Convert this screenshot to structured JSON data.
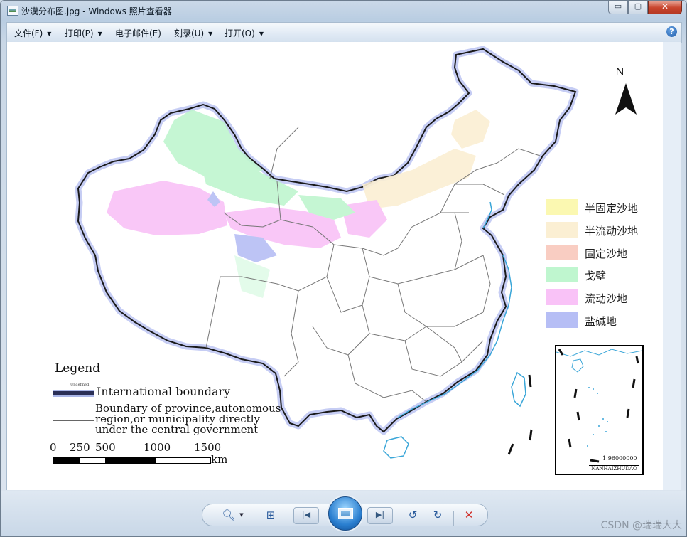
{
  "window": {
    "title": "沙漠分布图.jpg - Windows 照片查看器",
    "controls": {
      "minimize": "▭",
      "maximize": "▢",
      "close": "✕"
    }
  },
  "menu": {
    "items": [
      {
        "label": "文件(F)",
        "has_dropdown": true
      },
      {
        "label": "打印(P)",
        "has_dropdown": true
      },
      {
        "label": "电子邮件(E)",
        "has_dropdown": false
      },
      {
        "label": "刻录(U)",
        "has_dropdown": true
      },
      {
        "label": "打开(O)",
        "has_dropdown": true
      }
    ],
    "dropdown_glyph": "▼",
    "help_glyph": "?"
  },
  "map": {
    "north_label": "N",
    "legend": {
      "title": "Legend",
      "undefined_tag": "Undefined",
      "international_boundary": "International boundary",
      "province_boundary": "Boundary of province,autonomous region,or municipality directly under the central government",
      "scale_labels": [
        "0",
        "250",
        "500",
        "1000",
        "1500"
      ],
      "scale_unit": "km"
    },
    "key": [
      {
        "label": "半固定沙地",
        "color": "#fbf8b1"
      },
      {
        "label": "半流动沙地",
        "color": "#fbefd3"
      },
      {
        "label": "固定沙地",
        "color": "#f9cdc2"
      },
      {
        "label": "戈壁",
        "color": "#bff6cf"
      },
      {
        "label": "流动沙地",
        "color": "#f9c2f7"
      },
      {
        "label": "盐碱地",
        "color": "#b6bef5"
      }
    ],
    "inset": {
      "scale": "1:96000000",
      "name": "NANHAIZHUDAO"
    }
  },
  "toolbar": {
    "zoom_icon": "zoom-icon",
    "fit_icon": "actual-size-icon",
    "prev_icon": "previous-icon",
    "slideshow_icon": "slideshow-icon",
    "next_icon": "next-icon",
    "rotate_ccw_icon": "rotate-counterclockwise-icon",
    "rotate_cw_icon": "rotate-clockwise-icon",
    "delete_icon": "delete-icon"
  },
  "watermark": "CSDN @瑞瑞大大"
}
